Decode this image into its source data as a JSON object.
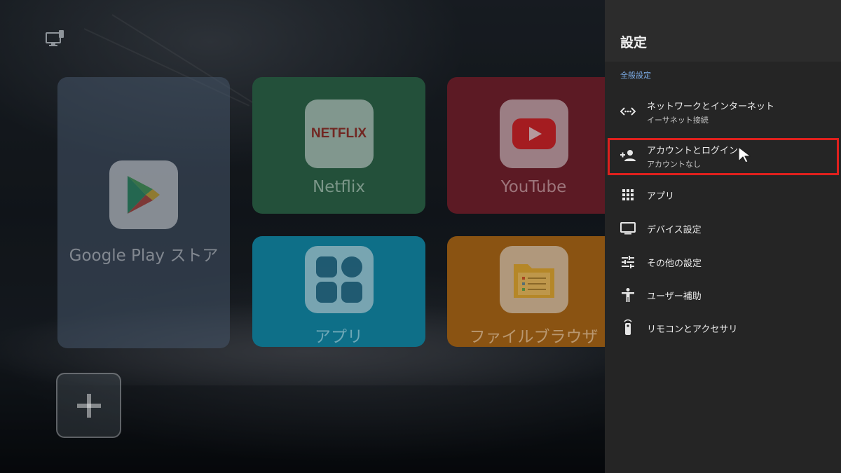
{
  "home": {
    "tiles": [
      {
        "id": "google-play",
        "label": "Google Play ストア"
      },
      {
        "id": "netflix",
        "label": "Netflix",
        "icon_text": "NETFLIX"
      },
      {
        "id": "youtube",
        "label": "YouTube"
      },
      {
        "id": "apps",
        "label": "アプリ"
      },
      {
        "id": "file-browser",
        "label": "ファイルブラウザ"
      }
    ]
  },
  "settings": {
    "title": "設定",
    "section_label": "全般設定",
    "items": [
      {
        "label": "ネットワークとインターネット",
        "sublabel": "イーサネット接続",
        "icon": "network-icon"
      },
      {
        "label": "アカウントとログイン",
        "sublabel": "アカウントなし",
        "icon": "add-account-icon",
        "selected": true
      },
      {
        "label": "アプリ",
        "icon": "apps-grid-icon"
      },
      {
        "label": "デバイス設定",
        "icon": "tv-icon"
      },
      {
        "label": "その他の設定",
        "icon": "sliders-icon"
      },
      {
        "label": "ユーザー補助",
        "icon": "accessibility-icon"
      },
      {
        "label": "リモコンとアクセサリ",
        "icon": "remote-icon"
      }
    ]
  },
  "colors": {
    "panel_bg": "#252525",
    "section_accent": "#7fb0ec",
    "focus_outline": "#e0201d",
    "netflix_red": "#b1060f",
    "youtube_red": "#e01e1e"
  }
}
